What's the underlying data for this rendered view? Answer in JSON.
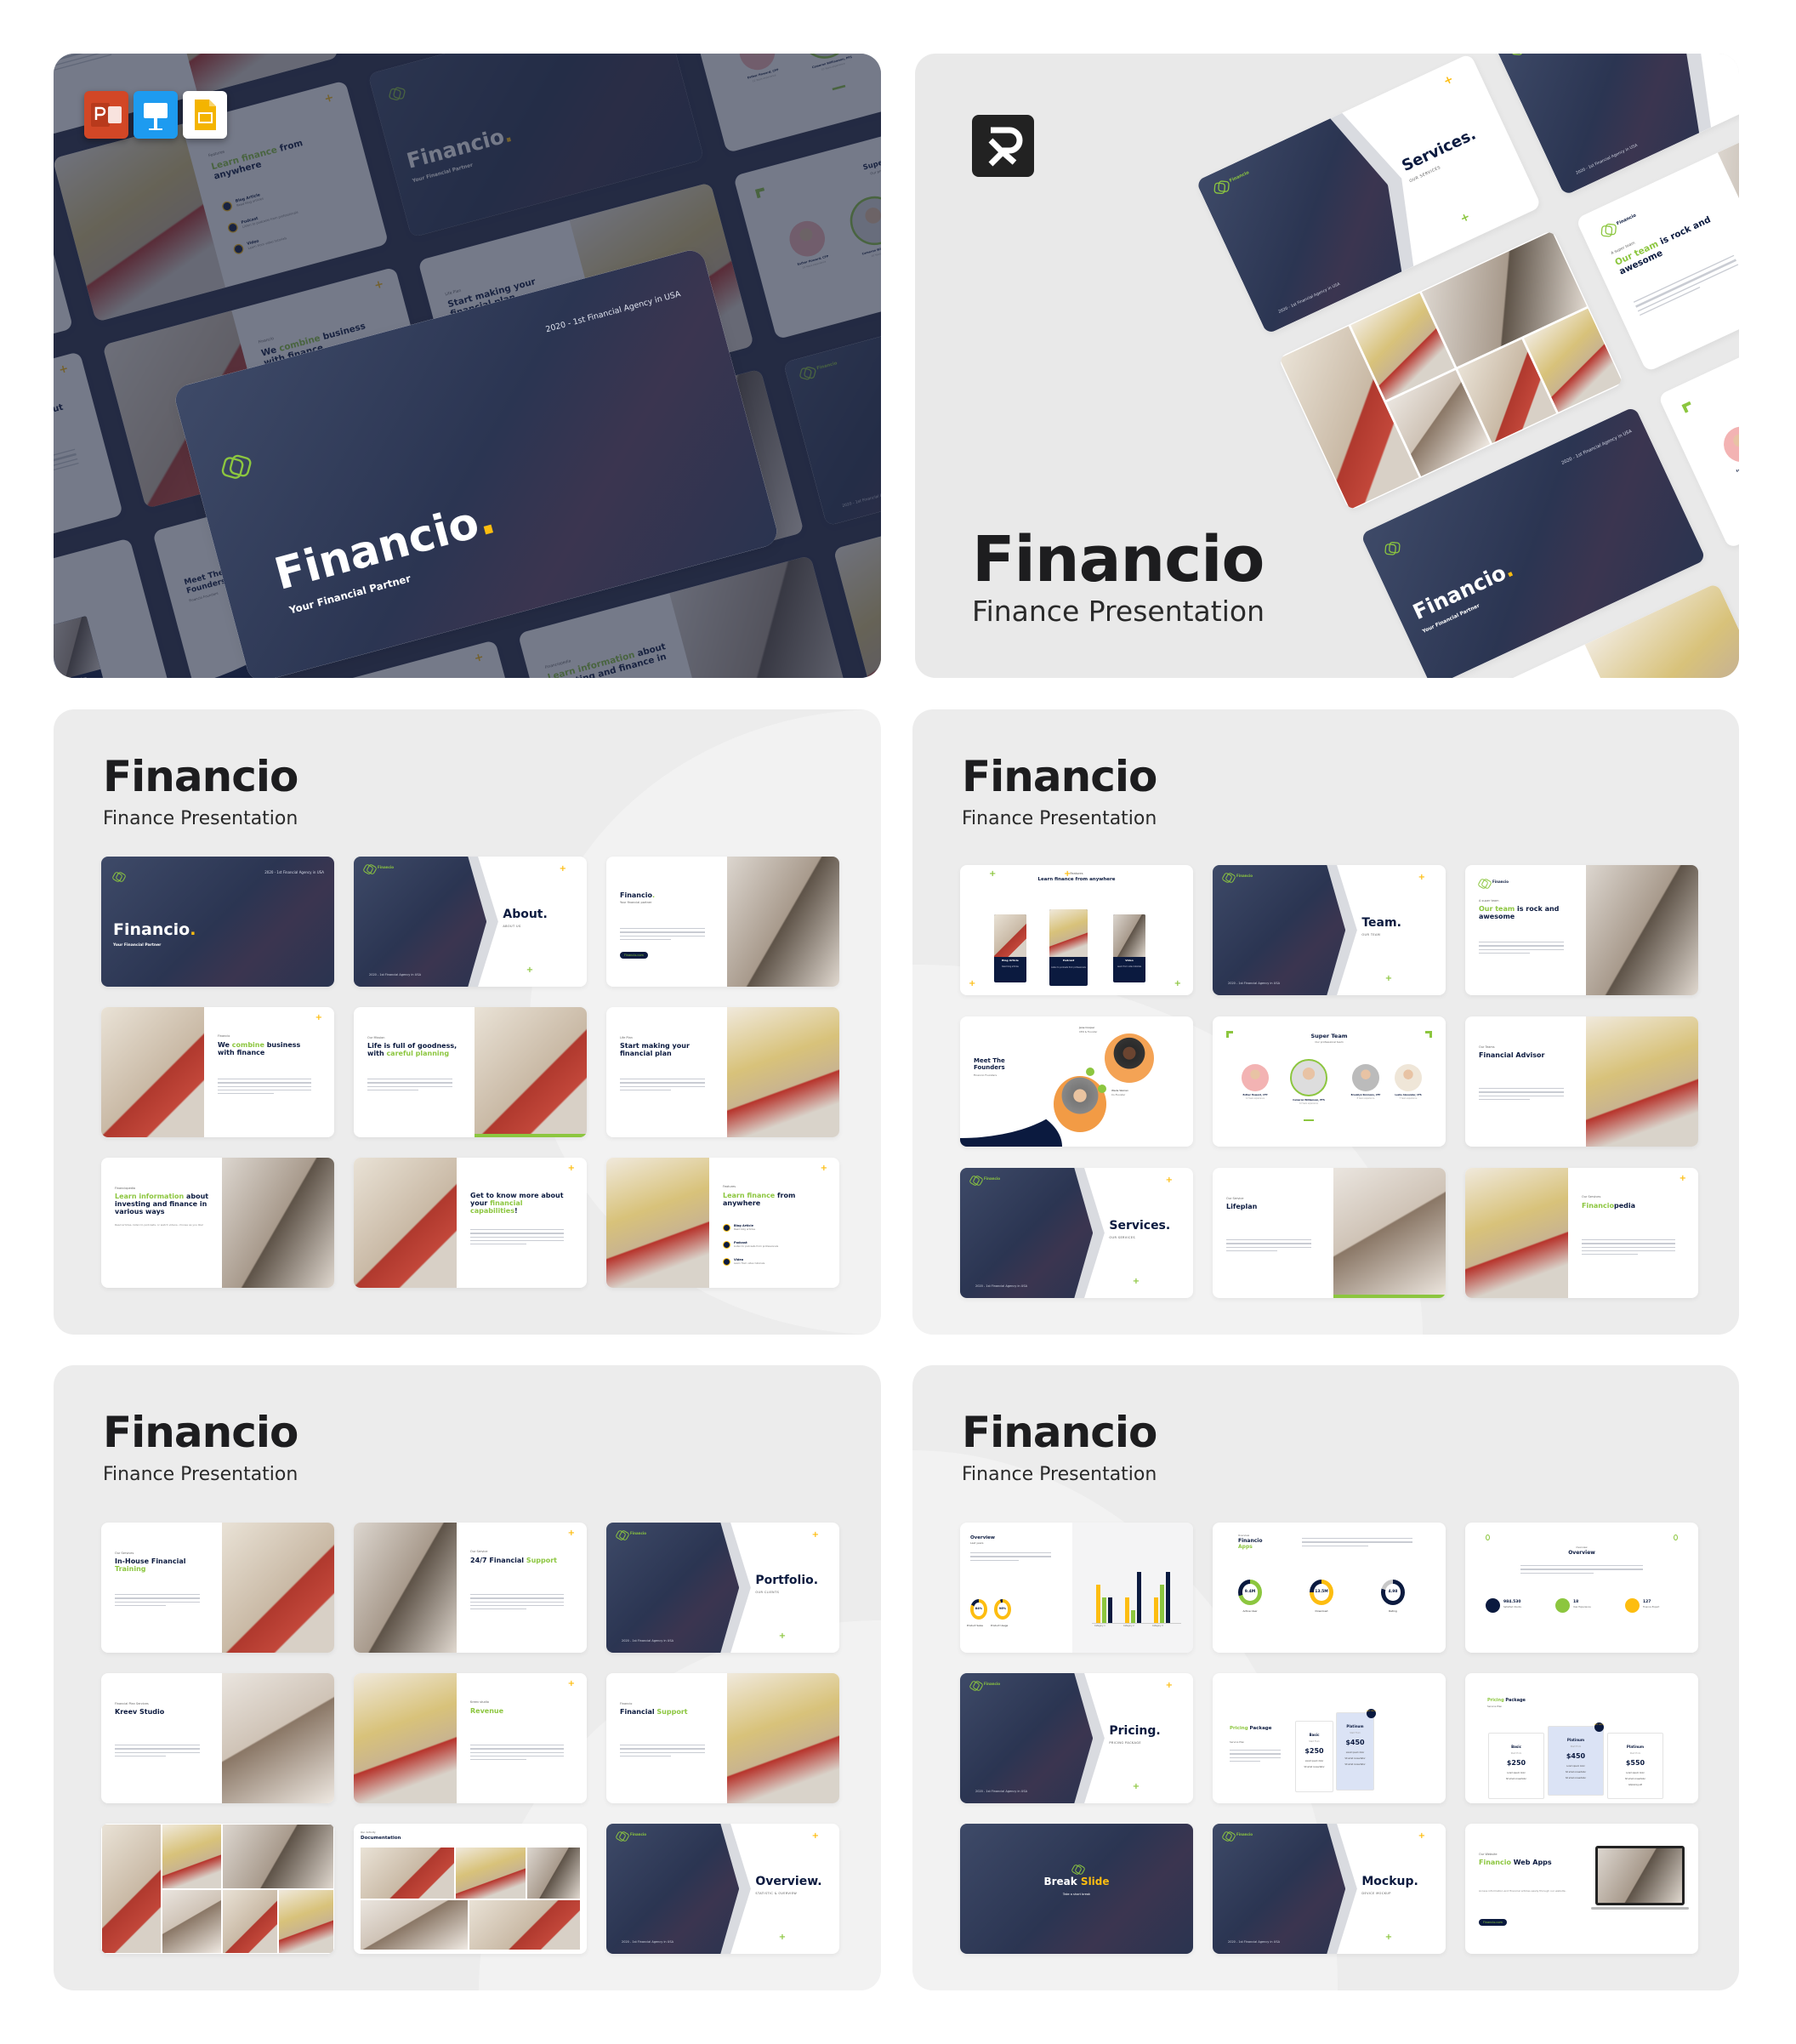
{
  "colors": {
    "navy": "#0b1a3f",
    "green": "#8cc63f",
    "yellow": "#fdbd10",
    "panel": "#ececec",
    "hero_dark": "#2a3049"
  },
  "hero_left": {
    "app_icons": [
      "powerpoint-icon",
      "keynote-icon",
      "google-slides-icon"
    ],
    "cover": {
      "title": [
        {
          "text": "Financio"
        },
        {
          "text": ".",
          "accent": "yellow"
        }
      ],
      "subtitle": "Your Financial Partner",
      "tagline": "2020 - 1st Financial Agency in USA"
    }
  },
  "hero_right": {
    "title": "Financio",
    "subtitle": "Finance Presentation"
  },
  "panels": [
    {
      "title": "Financio",
      "subtitle": "Finance Presentation",
      "slides": [
        {
          "type": "cover",
          "title": [
            {
              "text": "Financio"
            },
            {
              "text": ".",
              "accent": "yellow"
            }
          ],
          "subtitle": "Your Financial Partner",
          "tagline": "2020 - 1st Financial Agency in USA"
        },
        {
          "type": "section",
          "brand": "Financio",
          "title": [
            {
              "text": "About."
            }
          ],
          "subtitle": "ABOUT US",
          "tagline": "2020 - 1st Financial Agency in USA"
        },
        {
          "type": "textphoto",
          "title": [
            {
              "text": "Financio"
            },
            {
              "text": ".",
              "accent": "green"
            }
          ],
          "kicker_below": "Your financial partner",
          "button": "Financio.com"
        },
        {
          "type": "phototext",
          "kicker": "Financio",
          "title": [
            {
              "text": "We "
            },
            {
              "text": "combine",
              "accent": "green"
            },
            {
              "text": " business with finance"
            }
          ]
        },
        {
          "type": "textphoto",
          "kicker": "Our Mission",
          "title": [
            {
              "text": "Life is full of goodness, with "
            },
            {
              "text": "careful planning",
              "accent": "green"
            }
          ]
        },
        {
          "type": "textphoto",
          "kicker": "Life Plan",
          "title": [
            {
              "text": "Start making your financial plan"
            }
          ]
        },
        {
          "type": "textphoto",
          "kicker": "Financiopedia",
          "title": [
            {
              "text": "Learn information",
              "accent": "green"
            },
            {
              "text": " about investing and finance in various ways"
            }
          ],
          "body": "Read articles, listen to podcasts, or watch videos, choose as you like!"
        },
        {
          "type": "phototext",
          "title": [
            {
              "text": "Get to know more about your "
            },
            {
              "text": "financial capabilities",
              "accent": "green"
            },
            {
              "text": "!"
            }
          ]
        },
        {
          "type": "phototext",
          "kicker": "Features",
          "title": [
            {
              "text": "Learn finance",
              "accent": "green"
            },
            {
              "text": " from anywhere"
            }
          ],
          "items": [
            {
              "label": "Blog Article",
              "desc": "Read blog articles"
            },
            {
              "label": "Podcast",
              "desc": "Listen to podcasts from professionals"
            },
            {
              "label": "Video",
              "desc": "Learn from video tutorials"
            }
          ]
        }
      ]
    },
    {
      "title": "Financio",
      "subtitle": "Finance Presentation",
      "slides": [
        {
          "type": "features",
          "kicker": "Features",
          "title": [
            {
              "text": "Learn finance from anywhere"
            }
          ],
          "cards": [
            {
              "label": "Blog Article",
              "desc": "Read blog articles"
            },
            {
              "label": "Podcast",
              "desc": "Listen to podcasts from professionals"
            },
            {
              "label": "Video",
              "desc": "Learn from video tutorials"
            }
          ]
        },
        {
          "type": "section",
          "brand": "Financio",
          "title": [
            {
              "text": "Team."
            }
          ],
          "subtitle": "OUR TEAM",
          "tagline": "2020 - 1st Financial Agency in USA"
        },
        {
          "type": "textphoto",
          "brand": "Financio",
          "kicker": "A super team",
          "title": [
            {
              "text": "Our team",
              "accent": "green"
            },
            {
              "text": " is rock and awesome"
            }
          ]
        },
        {
          "type": "founders",
          "title": [
            {
              "text": "Meet The Founders"
            }
          ],
          "subtitle": "Financio Founders",
          "people": [
            {
              "name": "Jane Cooper",
              "role": "CEO & Founder",
              "num": "1"
            },
            {
              "name": "Wade Warren",
              "role": "Co-Founder",
              "num": "2"
            }
          ]
        },
        {
          "type": "team",
          "title": [
            {
              "text": "Super Team"
            }
          ],
          "subtitle": "Our professional team",
          "members": [
            {
              "name": "Esther Howard, CFP",
              "exp": "12 Years experience"
            },
            {
              "name": "Cameron Williamson, PFS",
              "exp": "10 Years experience"
            },
            {
              "name": "Brooklyn Simmons, CFP",
              "exp": "8 Years experience"
            },
            {
              "name": "Leslie Alexander, CFS",
              "exp": "7 Years experience"
            }
          ]
        },
        {
          "type": "textphoto",
          "kicker": "Our Teams",
          "title": [
            {
              "text": "Financial Advisor"
            }
          ]
        },
        {
          "type": "section",
          "brand": "Financio",
          "title": [
            {
              "text": "Services."
            }
          ],
          "subtitle": "OUR SERVICES",
          "tagline": "2020 - 1st Financial Agency in USA"
        },
        {
          "type": "textphoto",
          "kicker": "Our Service",
          "title": [
            {
              "text": "Lifeplan"
            }
          ]
        },
        {
          "type": "phototext",
          "kicker": "Our Services",
          "title": [
            {
              "text": "Financio",
              "accent": "green"
            },
            {
              "text": "pedia"
            }
          ]
        }
      ]
    },
    {
      "title": "Financio",
      "subtitle": "Finance Presentation",
      "slides": [
        {
          "type": "textphoto",
          "kicker": "Our Services",
          "title": [
            {
              "text": "In-House Financial "
            },
            {
              "text": "Training",
              "accent": "green"
            }
          ]
        },
        {
          "type": "phototext",
          "kicker": "Our Service",
          "title": [
            {
              "text": "24/7 Financial "
            },
            {
              "text": "Support",
              "accent": "green"
            }
          ]
        },
        {
          "type": "section",
          "brand": "Financio",
          "title": [
            {
              "text": "Portfolio."
            }
          ],
          "subtitle": "OUR CLIENTS",
          "tagline": "2020 - 1st Financial Agency in USA"
        },
        {
          "type": "textphoto",
          "kicker": "Financial Plan Services",
          "title": [
            {
              "text": "Kreev Studio"
            }
          ]
        },
        {
          "type": "phototext",
          "kicker": "Kreev studio",
          "title": [
            {
              "text": "Revenue",
              "accent": "green"
            }
          ]
        },
        {
          "type": "textphoto",
          "kicker": "Financio",
          "title": [
            {
              "text": "Financial "
            },
            {
              "text": "Support",
              "accent": "green"
            }
          ]
        },
        {
          "type": "collage"
        },
        {
          "type": "documentation",
          "kicker": "Our Activity",
          "title": [
            {
              "text": "Documentation"
            }
          ]
        },
        {
          "type": "section",
          "brand": "Financio",
          "title": [
            {
              "text": "Overview."
            }
          ],
          "subtitle": "STATISTIC & OVERVIEW",
          "tagline": "2020 - 1st Financial Agency in USA"
        }
      ]
    },
    {
      "title": "Financio",
      "subtitle": "Finance Presentation",
      "slides": [
        {
          "type": "chart",
          "title": [
            {
              "text": "Overview"
            }
          ],
          "subtitle": "Last years",
          "donuts": [
            {
              "value": "84%",
              "label": "Product Sales",
              "fill": 0.84
            },
            {
              "value": "96%",
              "label": "Product Usage",
              "fill": 0.96
            }
          ],
          "bars": {
            "categories": [
              "Category 1",
              "Category 2",
              "Category 3"
            ],
            "values": [
              [
                75,
                50,
                50
              ],
              [
                50,
                25,
                100
              ],
              [
                50,
                75,
                100
              ]
            ]
          }
        },
        {
          "type": "donuts",
          "kicker": "Overview",
          "title": [
            {
              "text": "Financio "
            },
            {
              "text": "Apps",
              "accent": "green"
            }
          ],
          "donuts": [
            {
              "value": "9.4M",
              "label": "Active User",
              "fill": 0.7,
              "color": "green"
            },
            {
              "value": "13.5M",
              "label": "Download",
              "fill": 0.75,
              "color": "yellow"
            },
            {
              "value": "4.98",
              "label": "Rating",
              "fill": 0.8,
              "color": "navy"
            }
          ]
        },
        {
          "type": "stats",
          "kicker": "Overview",
          "title": [
            {
              "text": "Overview"
            }
          ],
          "stats": [
            {
              "value": "984.530",
              "label": "Satisfied Clients",
              "icon": "users-icon",
              "color": "navy"
            },
            {
              "value": "18",
              "label": "Year Experience",
              "icon": "clock-icon",
              "color": "green"
            },
            {
              "value": "127",
              "label": "Finance Expert",
              "icon": "briefcase-icon",
              "color": "yellow"
            }
          ]
        },
        {
          "type": "section",
          "brand": "Financio",
          "title": [
            {
              "text": "Pricing."
            }
          ],
          "subtitle": "PRICING PACKAGE",
          "tagline": "2020 - 1st Financial Agency in USA"
        },
        {
          "type": "pricing",
          "title": [
            {
              "text": "Pricing",
              "accent": "green"
            },
            {
              "text": " Package"
            }
          ],
          "subtitle": "Service Plan",
          "badge": "BEST CHOICE",
          "plans": [
            {
              "name": "Basic",
              "from": "Start From",
              "price": "$250",
              "features": [
                "Lorem ipsum dolor",
                "Sit amet consectetur"
              ]
            },
            {
              "name": "Platinum",
              "from": "Start From",
              "price": "$450",
              "features": [
                "Lorem ipsum dolor",
                "Sit amet consectetur",
                "Sit amet consectetur"
              ],
              "featured": true
            }
          ]
        },
        {
          "type": "pricing3",
          "title": [
            {
              "text": "Pricing",
              "accent": "green"
            },
            {
              "text": " Package"
            }
          ],
          "subtitle": "Service Plan",
          "badge": "BEST CHOICE",
          "plans": [
            {
              "name": "Basic",
              "from": "Start From",
              "price": "$250",
              "features": [
                "Lorem ipsum dolor",
                "Sit amet consectetur"
              ]
            },
            {
              "name": "Platinum",
              "from": "Start From",
              "price": "$450",
              "features": [
                "Lorem ipsum dolor",
                "Sit amet consectetur",
                "Sit amet consectetur"
              ],
              "featured": true
            },
            {
              "name": "Platinum",
              "from": "Start From",
              "price": "$550",
              "features": [
                "Lorem ipsum dolor",
                "Sit amet consectetur",
                "Adipiscing elit"
              ]
            }
          ]
        },
        {
          "type": "break",
          "title": [
            {
              "text": "Break "
            },
            {
              "text": "Slide",
              "accent": "yellow"
            }
          ],
          "subtitle": "Take a short break"
        },
        {
          "type": "section",
          "brand": "Financio",
          "title": [
            {
              "text": "Mockup."
            }
          ],
          "subtitle": "DEVICE MOCKUP",
          "tagline": "2020 - 1st Financial Agency in USA"
        },
        {
          "type": "textphoto",
          "kicker": "Our Website",
          "title": [
            {
              "text": "Financio",
              "accent": "green"
            },
            {
              "text": " Web Apps"
            }
          ],
          "body": "Access information and financial articles easily through our website.",
          "button": "Financio.com",
          "laptop": true
        }
      ]
    }
  ]
}
